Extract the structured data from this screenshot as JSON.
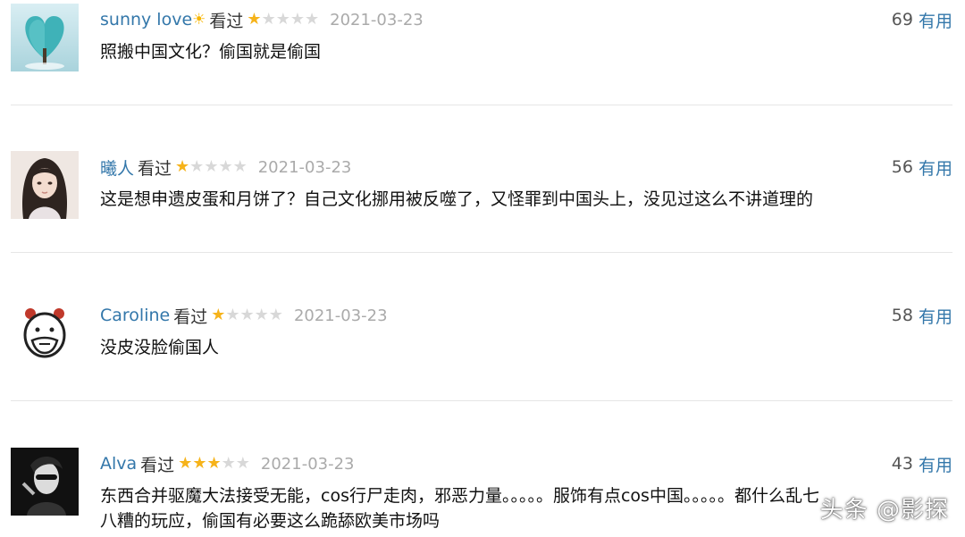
{
  "reviews": [
    {
      "user": "sunny love",
      "user_emoji": "☀",
      "status": "看过",
      "rating": 1,
      "date": "2021-03-23",
      "votes": "69",
      "useful_label": "有用",
      "text_lines": [
        "照搬中国文化？偷国就是偷国"
      ],
      "avatar_icon": "tree-heart-avatar"
    },
    {
      "user": "曦人",
      "status": "看过",
      "rating": 1,
      "date": "2021-03-23",
      "votes": "56",
      "useful_label": "有用",
      "text_lines": [
        "这是想申遗皮蛋和月饼了？自己文化挪用被反噬了，又怪罪到中国头上，没见过这么不讲道理的"
      ],
      "avatar_icon": "anime-girl-avatar"
    },
    {
      "user": "Caroline",
      "status": "看过",
      "rating": 1,
      "date": "2021-03-23",
      "votes": "58",
      "useful_label": "有用",
      "text_lines": [
        "没皮没脸偷国人"
      ],
      "avatar_icon": "cartoon-face-avatar"
    },
    {
      "user": "Alva",
      "status": "看过",
      "rating": 3,
      "date": "2021-03-23",
      "votes": "43",
      "useful_label": "有用",
      "text_lines": [
        "东西合并驱魔大法接受无能，cos行尸走肉，邪恶力量。。。。。服饰有点cos中国。。。。。都什么乱七",
        "八糟的玩应，偷国有必要这么跪舔欧美市场吗"
      ],
      "avatar_icon": "dark-portrait-avatar"
    }
  ],
  "star_glyph": "★",
  "watermark": "头条 @影探",
  "colors": {
    "link": "#3377aa",
    "star_on": "#f6b31a",
    "star_off": "#d8d8d8",
    "date": "#aaaaaa"
  }
}
